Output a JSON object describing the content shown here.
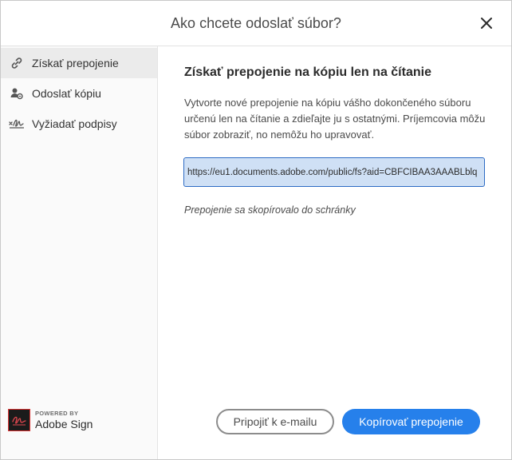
{
  "dialog": {
    "title": "Ako chcete odoslať súbor?",
    "close_icon": "close-icon"
  },
  "sidebar": {
    "items": [
      {
        "label": "Získať prepojenie",
        "icon": "link-icon",
        "active": true
      },
      {
        "label": "Odoslať kópiu",
        "icon": "send-copy-icon",
        "active": false
      },
      {
        "label": "Vyžiadať podpisy",
        "icon": "signature-icon",
        "active": false
      }
    ],
    "brand": {
      "powered_by": "POWERED BY",
      "name": "Adobe Sign"
    }
  },
  "main": {
    "title": "Získať prepojenie na kópiu len na čítanie",
    "description": "Vytvorte nové prepojenie na kópiu vášho dokončeného súboru určenú len na čítanie a zdieľajte ju s ostatnými. Príjemcovia môžu súbor zobraziť, no nemôžu ho upravovať.",
    "link_value": "https://eu1.documents.adobe.com/public/fs?aid=CBFCIBAA3AAABLblq",
    "copied_note": "Prepojenie sa skopírovalo do schránky"
  },
  "buttons": {
    "attach_email": "Pripojiť k e-mailu",
    "copy_link": "Kopírovať prepojenie"
  },
  "colors": {
    "primary": "#2680eb",
    "focus_border": "#2d6bc4",
    "sidebar_active": "#ebebeb"
  }
}
